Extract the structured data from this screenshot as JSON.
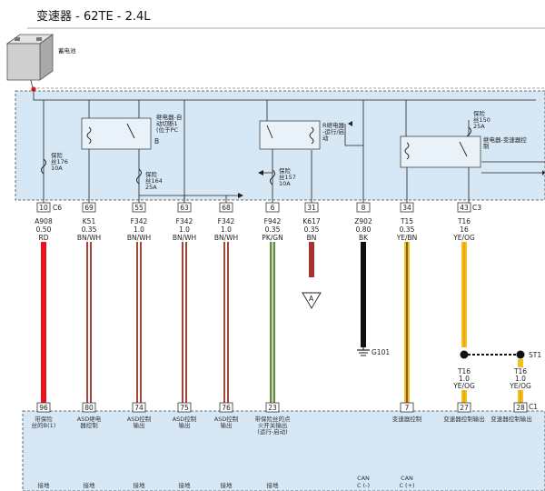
{
  "title": "变速器 - 62TE - 2.4L",
  "battery_label": "蓄电池",
  "fuses": [
    {
      "text": "保险\n丝176\n10A"
    },
    {
      "text": "保险\n丝164\n25A"
    },
    {
      "text": "保险\n丝157\n10A"
    },
    {
      "text": "保险\n丝150\n25A"
    }
  ],
  "relays": [
    {
      "text": "继电器-自\n动切断1\n(位于PC",
      "tag": "B",
      "pins": [
        "85",
        "30",
        "86",
        "87",
        "87A"
      ]
    },
    {
      "text": "R继电器\n-运行/启\n动",
      "pins": [
        "85",
        "30",
        "86",
        "87A",
        "87"
      ]
    },
    {
      "text": "继电器-变速器控\n制",
      "pins": [
        "85",
        "30",
        "86",
        "87A",
        "87"
      ]
    }
  ],
  "top_connector": {
    "left_id": "C6",
    "right_id": "C3"
  },
  "wires": [
    {
      "pin": "10",
      "circuit": "A908",
      "gauge": "0.50",
      "color": "RD",
      "bottom_pin": "96",
      "bottom_label": "带保险\n丝的B(1)",
      "bottom_sub": "接地"
    },
    {
      "pin": "69",
      "circuit": "K51",
      "gauge": "0.35",
      "color": "BN/WH",
      "bottom_pin": "80",
      "bottom_label": "ASD继电\n器控制",
      "bottom_sub": "接地"
    },
    {
      "pin": "55",
      "circuit": "F342",
      "gauge": "1.0",
      "color": "BN/WH",
      "bottom_pin": "74",
      "bottom_label": "ASD控制\n输出",
      "bottom_sub": "接地"
    },
    {
      "pin": "63",
      "circuit": "F342",
      "gauge": "1.0",
      "color": "BN/WH",
      "bottom_pin": "75",
      "bottom_label": "ASD控制\n输出",
      "bottom_sub": "接地"
    },
    {
      "pin": "68",
      "circuit": "F342",
      "gauge": "1.0",
      "color": "BN/WH",
      "bottom_pin": "76",
      "bottom_label": "ASD控制\n输出",
      "bottom_sub": "接地"
    },
    {
      "pin": "6",
      "circuit": "F942",
      "gauge": "0.35",
      "color": "PK/GN",
      "bottom_pin": "23",
      "bottom_label": "带保险丝的点\n火开关输出\n(运行-启动)",
      "bottom_sub": "接地"
    },
    {
      "pin": "31",
      "circuit": "K617",
      "gauge": "0.35",
      "color": "BN"
    },
    {
      "pin": "8",
      "circuit": "Z902",
      "gauge": "0.80",
      "color": "BK",
      "ground": "G101",
      "bottom_sub": "CAN\nC (-)"
    },
    {
      "pin": "34",
      "circuit": "T15",
      "gauge": "0.35",
      "color": "YE/BN",
      "bottom_pin": "7",
      "bottom_label": "变速器控制",
      "bottom_sub": "CAN\nC (+)"
    },
    {
      "pin": "43",
      "circuit": "T16",
      "gauge": "16",
      "color": "YE/OG",
      "bottom_pin": "27",
      "bottom_label": "变速器控制输出"
    }
  ],
  "splice_a": "A",
  "st_label": "ST1",
  "branch_wires": [
    {
      "circuit": "T16",
      "gauge": "1.0",
      "color": "YE/OG"
    },
    {
      "circuit": "T16",
      "gauge": "1.0",
      "color": "YE/OG",
      "bottom_pin": "28",
      "connector": "C1",
      "bottom_label": "变速器控制输出"
    }
  ],
  "colors": {
    "module_fill": "#d6e7f5",
    "RD": "#e8141b",
    "BN_WH": "#a1463c",
    "PK_GN": "#4a9a3a",
    "BN": "#a3342f",
    "BK": "#111111",
    "YE": "#f0c21c"
  }
}
